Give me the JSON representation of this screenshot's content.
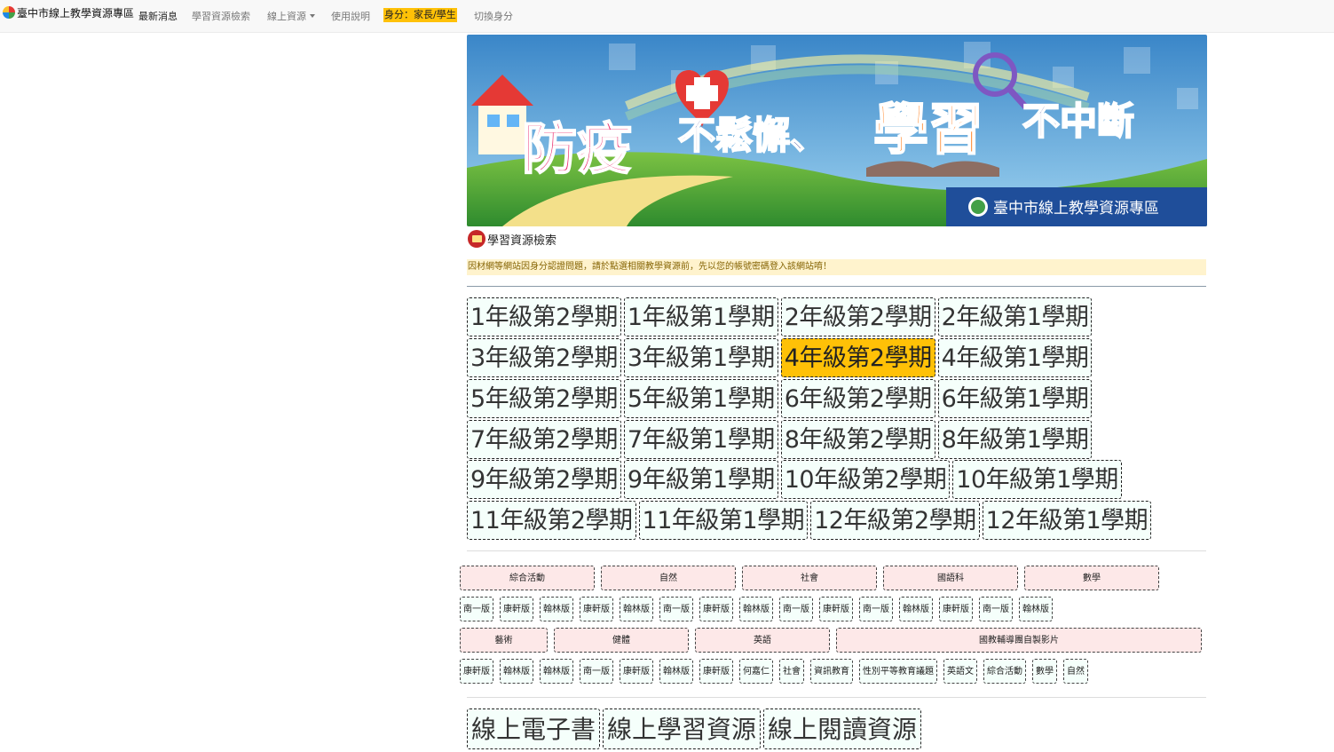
{
  "navbar": {
    "brand": "臺中市線上教學資源專區",
    "items": [
      "最新消息",
      "學習資源檢索",
      "線上資源",
      "使用說明"
    ],
    "identity": "身分：家長/學生",
    "switch_identity": "切換身分"
  },
  "banner": {
    "headline_1": "防疫",
    "headline_2": "不鬆懈、",
    "headline_3": "學習",
    "headline_4": "不中斷",
    "caption": "臺中市線上教學資源專區"
  },
  "section": {
    "title": "學習資源檢索",
    "notice": "因材網等網站因身分認證問題，請於點選相關教學資源前，先以您的帳號密碼登入該網站唷！"
  },
  "semesters": [
    [
      "1年級第2學期",
      "1年級第1學期",
      "2年級第2學期",
      "2年級第1學期"
    ],
    [
      "3年級第2學期",
      "3年級第1學期",
      "4年級第2學期",
      "4年級第1學期"
    ],
    [
      "5年級第2學期",
      "5年級第1學期",
      "6年級第2學期",
      "6年級第1學期"
    ],
    [
      "7年級第2學期",
      "7年級第1學期",
      "8年級第2學期",
      "8年級第1學期"
    ],
    [
      "9年級第2學期",
      "9年級第1學期",
      "10年級第2學期",
      "10年級第1學期"
    ],
    [
      "11年級第2學期",
      "11年級第1學期",
      "12年級第2學期",
      "12年級第1學期"
    ]
  ],
  "active_semester": "4年級第2學期",
  "subjects_row1": [
    "綜合活動",
    "自然",
    "社會",
    "國語科",
    "數學"
  ],
  "editions_row1": [
    "南一版",
    "康軒版",
    "翰林版",
    "康軒版",
    "翰林版",
    "南一版",
    "康軒版",
    "翰林版",
    "南一版",
    "康軒版",
    "南一版",
    "翰林版",
    "康軒版",
    "南一版",
    "翰林版"
  ],
  "subjects_row2": [
    "藝術",
    "健體",
    "英語",
    "國教輔導團自製影片"
  ],
  "editions_row2": [
    "康軒版",
    "翰林版",
    "翰林版",
    "南一版",
    "康軒版",
    "翰林版",
    "康軒版",
    "何嘉仁",
    "社會",
    "資訊教育",
    "性別平等教育議題",
    "英語文",
    "綜合活動",
    "數學",
    "自然"
  ],
  "bottom_links": [
    "線上電子書",
    "線上學習資源",
    "線上閱讀資源"
  ],
  "colors": {
    "active": "#ffc107",
    "subject_bg": "#fde8e8",
    "button_bg": "#f5fffb",
    "notice_bg": "#fff3cd"
  }
}
